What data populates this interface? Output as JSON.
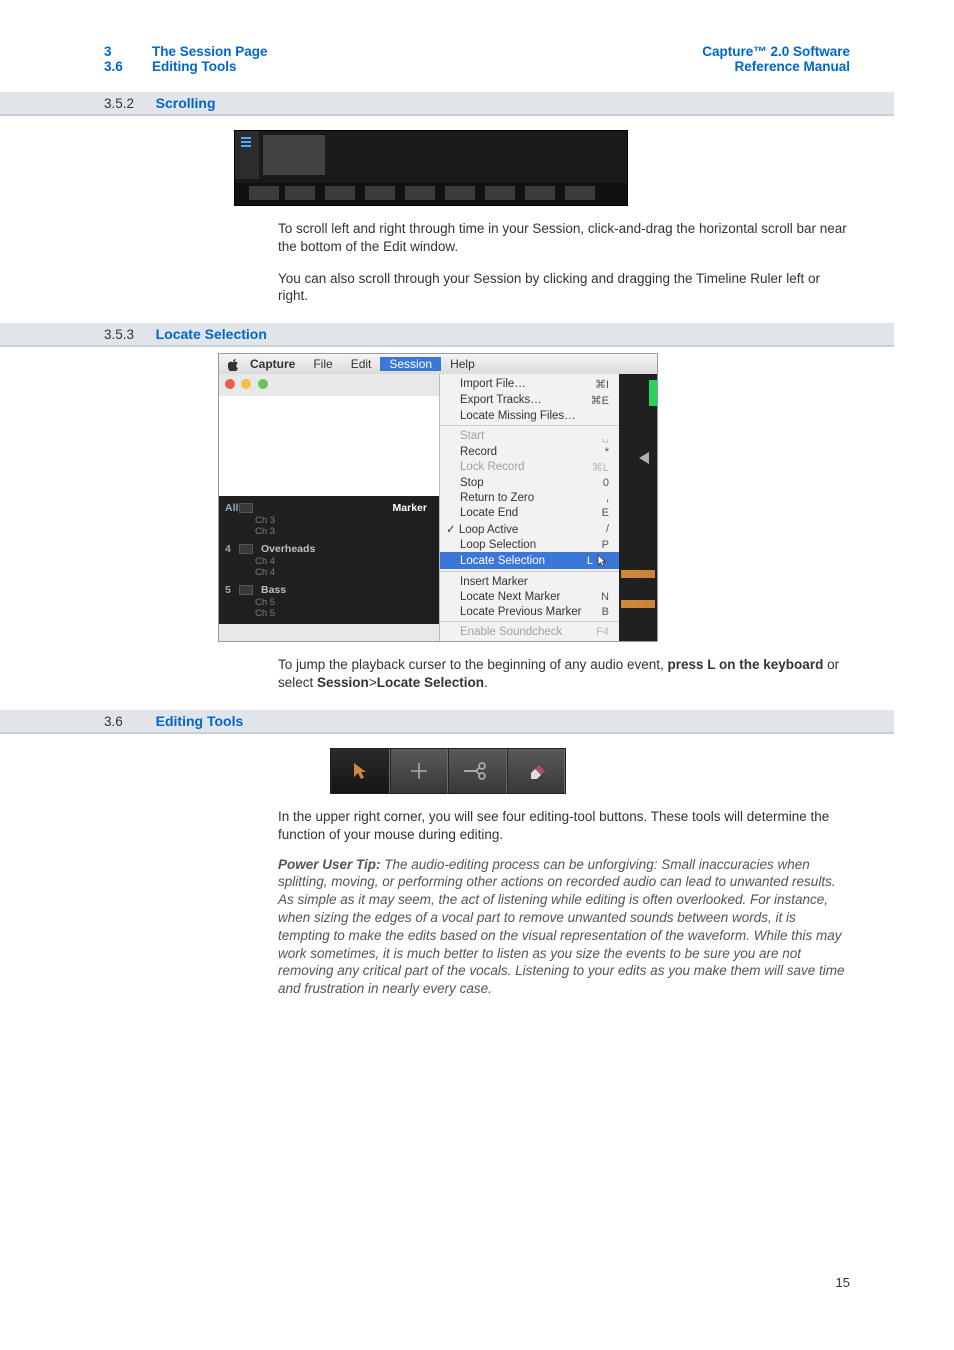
{
  "header": {
    "left": {
      "chapter_num": "3",
      "chapter_title": "The Session Page",
      "section_num": "3.6",
      "section_title": "Editing Tools"
    },
    "right": {
      "product": "Capture™ 2.0 Software",
      "subtitle": "Reference Manual"
    }
  },
  "sec_scrolling": {
    "num": "3.5.2",
    "title": "Scrolling",
    "para1": "To scroll left and right through time in your Session, click-and-drag the horizontal scroll bar near the bottom of the Edit window.",
    "para2": "You can also scroll through your Session by clicking and dragging the Timeline Ruler left or right."
  },
  "sec_locate": {
    "num": "3.5.3",
    "title": "Locate Selection",
    "menubar": {
      "capture": "Capture",
      "file": "File",
      "edit": "Edit",
      "session": "Session",
      "help": "Help"
    },
    "tracks": {
      "marker_label": "Marker",
      "row_all": "All",
      "all_sub1": "Ch 3",
      "all_sub2": "Ch 3",
      "row4": "4",
      "row4_name": "Overheads",
      "row4_sub1": "Ch 4",
      "row4_sub2": "Ch 4",
      "row5": "5",
      "row5_name": "Bass",
      "row5_sub1": "Ch 5",
      "row5_sub2": "Ch 5"
    },
    "menu_items": {
      "import": "Import File…",
      "import_sc": "⌘I",
      "export": "Export Tracks…",
      "export_sc": "⌘E",
      "missing": "Locate Missing Files…",
      "start": "Start",
      "start_sc": "␣",
      "record": "Record",
      "record_sc": "*",
      "lockrec": "Lock Record",
      "lockrec_sc": "⌘L",
      "stop": "Stop",
      "stop_sc": "0",
      "rtz": "Return to Zero",
      "rtz_sc": ",",
      "locend": "Locate End",
      "locend_sc": "E",
      "loopact": "Loop Active",
      "loopact_sc": "/",
      "loopsel": "Loop Selection",
      "loopsel_sc": "P",
      "locsel": "Locate Selection",
      "locsel_sc": "L",
      "insmark": "Insert Marker",
      "locnext": "Locate Next Marker",
      "locnext_sc": "N",
      "locprev": "Locate Previous Marker",
      "locprev_sc": "B",
      "sound": "Enable Soundcheck",
      "sound_sc": "F4"
    },
    "para_pre": "To jump the playback curser to the beginning of any audio event,",
    "para_bold": "press L on the keyboard",
    "para_mid": " or select ",
    "para_b2": "Session",
    "para_gt": ">",
    "para_b3": "Locate Selection",
    "para_end": "."
  },
  "sec_editing": {
    "num": "3.6",
    "title": "Editing Tools",
    "icons": {
      "arrow": "arrow-tool",
      "range": "range-tool",
      "split": "split-tool",
      "erase": "erase-tool"
    },
    "para1": "In the upper right corner, you will see four editing-tool buttons. These tools will determine the function of your mouse during editing.",
    "tip_label": "Power User Tip:",
    "tip_body": " The audio-editing process can be unforgiving: Small inaccuracies when splitting, moving, or performing other actions on recorded audio can lead to unwanted results. As simple as it may seem, the act of listening while editing is often overlooked. For instance, when sizing the edges of a vocal part to remove unwanted sounds between words, it is tempting to make the edits based on the visual representation of the waveform. While this may work sometimes, it is much better to listen as you size the events to be sure you are not removing any critical part of the vocals. Listening to your edits as you make them will save time and frustration in nearly every case."
  },
  "page_number": "15"
}
